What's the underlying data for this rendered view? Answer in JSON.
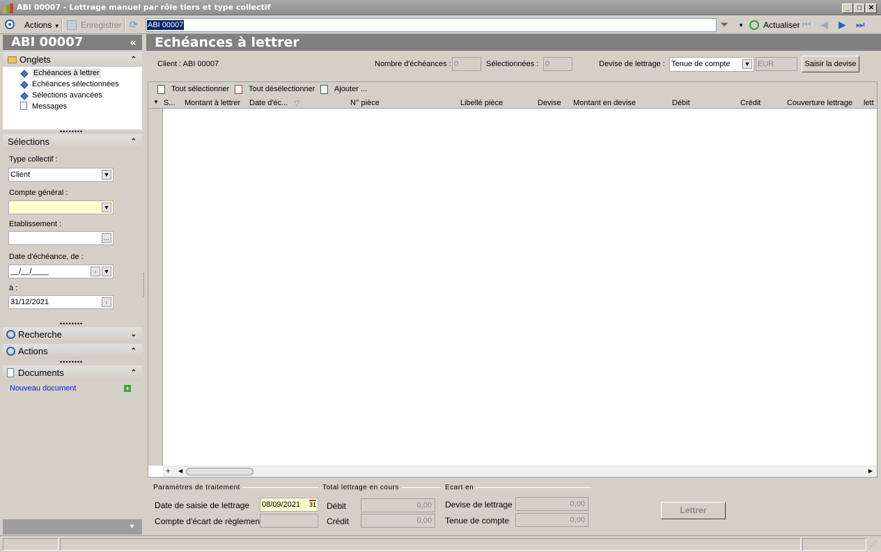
{
  "window": {
    "title": "ABI 00007 -  Lettrage manuel par rôle tiers et type collectif",
    "min": "_",
    "max": "□",
    "close": "✕"
  },
  "toolbar": {
    "actions": "Actions",
    "save": "Enregistrer",
    "command_value": "ABI 00007",
    "refresh": "Actualiser"
  },
  "left": {
    "title": "ABI 00007",
    "collapse": "«",
    "onglets": {
      "label": "Onglets",
      "items": [
        "Echéances à lettrer",
        "Echéances sélectionnées",
        "Sélections avancées",
        "Messages"
      ]
    },
    "selections": {
      "label": "Sélections",
      "type_collectif_label": "Type collectif :",
      "type_collectif_value": "Client",
      "compte_general_label": "Compte général :",
      "compte_general_value": "",
      "etablissement_label": "Etablissement :",
      "etablissement_value": "",
      "date_de_label": "Date d'échéance, de :",
      "date_de_value": "__/__/____",
      "date_a_label": "à :",
      "date_a_value": "31/12/2021"
    },
    "recherche": "Recherche",
    "actions": "Actions",
    "documents": "Documents",
    "new_doc": "Nouveau document"
  },
  "main": {
    "title": "Echéances à lettrer",
    "client": "Client : ABI 00007",
    "nb_label": "Nombre d'échéances :",
    "nb_value": "0",
    "sel_label": "Sélectionnées :",
    "sel_value": "0",
    "devise_label": "Devise de lettrage :",
    "devise_value": "Tenue de compte",
    "devise_code": "EUR",
    "saisir_btn": "Saisir la devise",
    "grid_tools": [
      "Tout sélectionner",
      "Tout désélectionner",
      "Ajouter ..."
    ],
    "columns": [
      "S...",
      "Montant à lettrer",
      "Date d'éc...",
      "N° pièce",
      "Libellé pièce",
      "Devise",
      "Montant en devise",
      "Débit",
      "Crédit",
      "Couverture lettrage",
      "lett"
    ],
    "params": {
      "title": "Paramètres de traitement",
      "date_label": "Date de saisie de lettrage",
      "date_value": "08/09/2021",
      "cal": "31",
      "ecart_label": "Compte d'écart de règlement",
      "ecart_value": ""
    },
    "total": {
      "title": "Total lettrage en cours",
      "debit_label": "Débit",
      "debit_value": "0,00",
      "credit_label": "Crédit",
      "credit_value": "0,00"
    },
    "ecart": {
      "title": "Ecart en",
      "devise_label": "Devise de lettrage",
      "devise_value": "0,00",
      "tenue_label": "Tenue de compte",
      "tenue_value": "0,00"
    },
    "lettrer_btn": "Lettrer"
  }
}
